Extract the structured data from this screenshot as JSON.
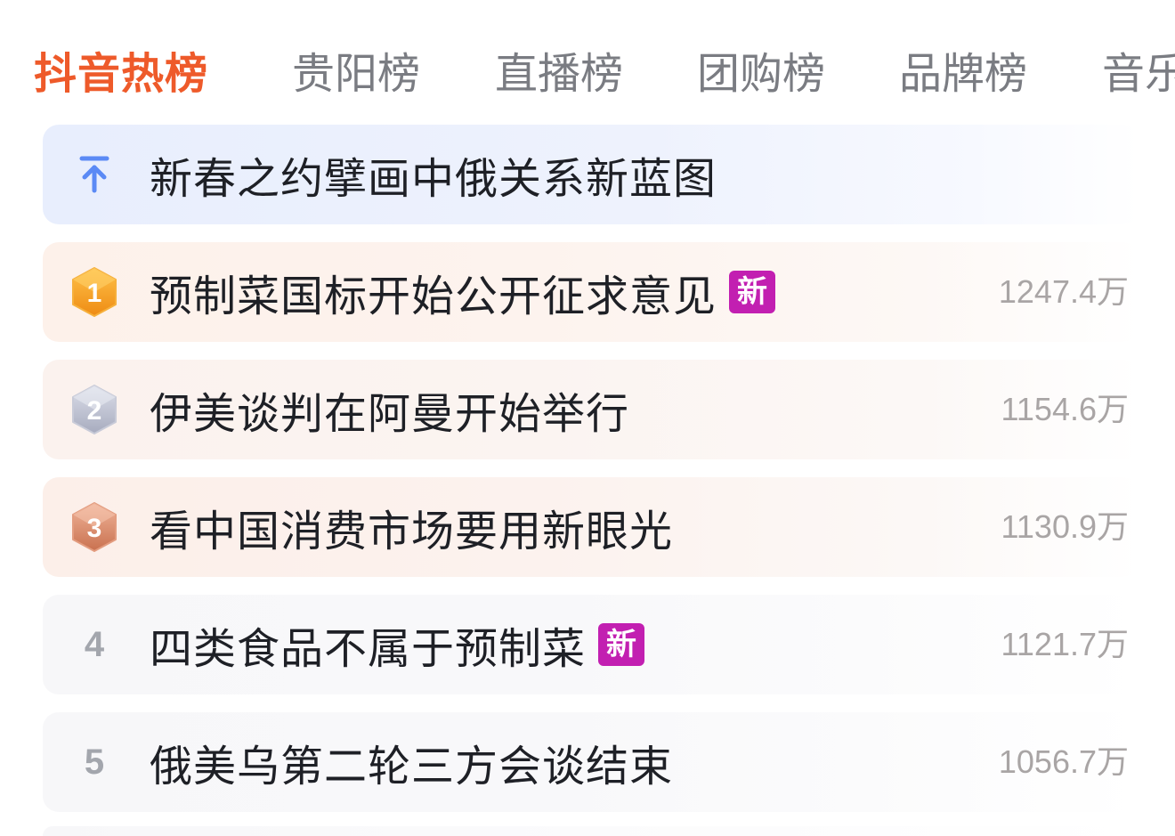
{
  "tabs": [
    {
      "label": "抖音热榜",
      "active": true
    },
    {
      "label": "贵阳榜",
      "active": false
    },
    {
      "label": "直播榜",
      "active": false
    },
    {
      "label": "团购榜",
      "active": false
    },
    {
      "label": "品牌榜",
      "active": false
    },
    {
      "label": "音乐",
      "active": false
    }
  ],
  "pinned": {
    "icon": "pin-top-arrow-icon",
    "title": "新春之约擘画中俄关系新蓝图"
  },
  "items": [
    {
      "rank": "1",
      "rank_icon": "gold-hexagon-icon",
      "title": "预制菜国标开始公开征求意见",
      "badge": "新",
      "heat": "1247.4万"
    },
    {
      "rank": "2",
      "rank_icon": "silver-hexagon-icon",
      "title": "伊美谈判在阿曼开始举行",
      "badge": "",
      "heat": "1154.6万"
    },
    {
      "rank": "3",
      "rank_icon": "bronze-hexagon-icon",
      "title": "看中国消费市场要用新眼光",
      "badge": "",
      "heat": "1130.9万"
    },
    {
      "rank": "4",
      "title": "四类食品不属于预制菜",
      "badge": "新",
      "heat": "1121.7万"
    },
    {
      "rank": "5",
      "title": "俄美乌第二轮三方会谈结束",
      "badge": "",
      "heat": "1056.7万"
    }
  ],
  "colors": {
    "active_tab": "#ee5a2a",
    "inactive_tab": "#7a7c82",
    "new_badge": "#c21fb1",
    "pin_arrow": "#5b8af5",
    "heat_text": "#a9a5a5",
    "gold": "#f3a12a",
    "silver": "#b9bccb",
    "bronze": "#d98a6e"
  }
}
